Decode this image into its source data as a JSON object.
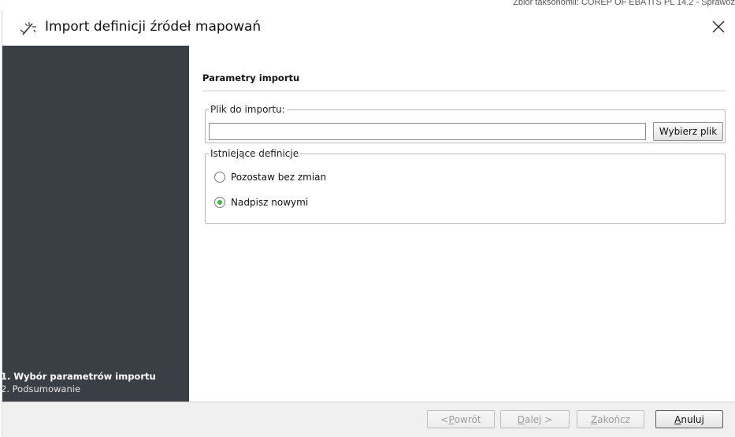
{
  "background": {
    "window_text": "Zbiór taksonomii: COREP OF EBA ITS PL 14.2 - Sprawoz"
  },
  "dialog": {
    "title": "Import definicji źródeł mapowań",
    "icon": "wizard-wand-icon",
    "close_icon": "close-icon"
  },
  "sidebar": {
    "steps": [
      {
        "label": "1. Wybór parametrów importu",
        "active": true
      },
      {
        "label": "2. Podsumowanie",
        "active": false
      }
    ]
  },
  "main": {
    "section_title": "Parametry importu",
    "file_group": {
      "legend": "Plik do importu:",
      "value": "",
      "browse_label": "Wybierz plik"
    },
    "defs_group": {
      "legend": "Istniejące definicje",
      "options": [
        {
          "label": "Pozostaw bez zmian",
          "checked": false
        },
        {
          "label": "Nadpisz nowymi",
          "checked": true
        }
      ]
    }
  },
  "footer": {
    "back_prefix": "< ",
    "back_mnemonic": "P",
    "back_rest": "owrót",
    "next_mnemonic": "D",
    "next_rest": "alej >",
    "finish_mnemonic": "Z",
    "finish_rest": "akończ",
    "cancel_mnemonic": "A",
    "cancel_rest": "nuluj"
  },
  "colors": {
    "sidebar_bg": "#3a3e45",
    "radio_selected": "#3fb83f"
  }
}
